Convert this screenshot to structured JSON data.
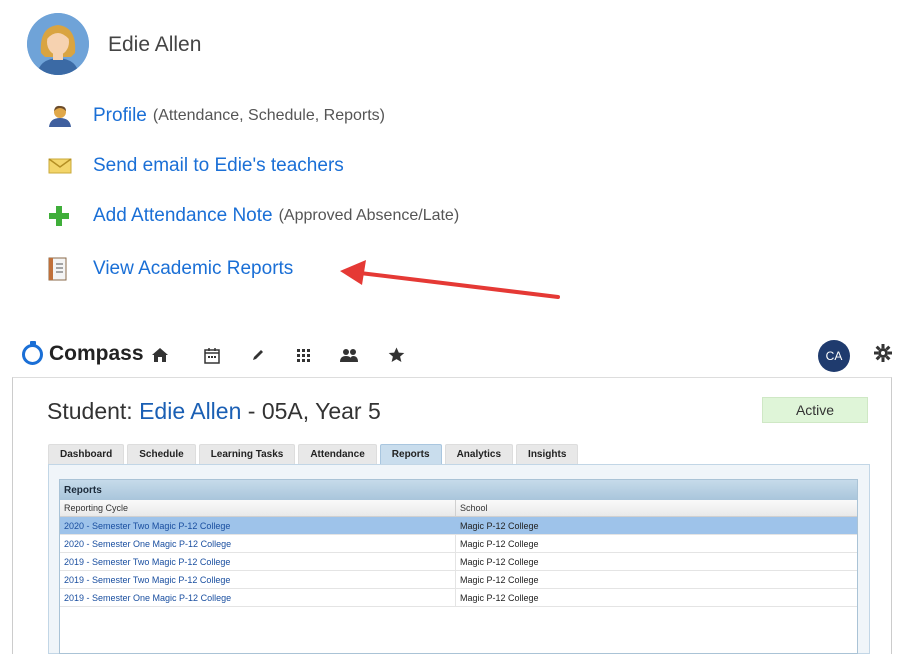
{
  "student": {
    "name": "Edie Allen"
  },
  "menu": {
    "items": [
      {
        "label": "Profile",
        "note": "(Attendance, Schedule, Reports)",
        "icon": "profile-icon"
      },
      {
        "label": "Send email to Edie's teachers",
        "note": "",
        "icon": "envelope-icon"
      },
      {
        "label": "Add Attendance Note",
        "note": "(Approved Absence/Late)",
        "icon": "plus-icon"
      },
      {
        "label": "View Academic Reports",
        "note": "",
        "icon": "report-book-icon"
      }
    ]
  },
  "annotation": {
    "arrow_color": "#e53935"
  },
  "compass": {
    "brand": "Compass",
    "toolbar_icons": [
      "home-icon",
      "calendar-icon",
      "pencil-icon",
      "apps-grid-icon",
      "people-icon",
      "star-icon"
    ],
    "user_initials": "CA",
    "accent": "#1a6fd6"
  },
  "page": {
    "title_prefix": "Student: ",
    "student_link": "Edie Allen",
    "title_suffix": " - 05A, Year 5",
    "status": "Active"
  },
  "tabs": [
    {
      "label": "Dashboard",
      "active": false
    },
    {
      "label": "Schedule",
      "active": false
    },
    {
      "label": "Learning Tasks",
      "active": false
    },
    {
      "label": "Attendance",
      "active": false
    },
    {
      "label": "Reports",
      "active": true
    },
    {
      "label": "Analytics",
      "active": false
    },
    {
      "label": "Insights",
      "active": false
    }
  ],
  "reports": {
    "title": "Reports",
    "columns": [
      "Reporting Cycle",
      "School"
    ],
    "rows": [
      {
        "cycle": "2020 - Semester Two Magic P-12 College",
        "school": "Magic P-12 College",
        "selected": true
      },
      {
        "cycle": "2020 - Semester One Magic P-12 College",
        "school": "Magic P-12 College",
        "selected": false
      },
      {
        "cycle": "2019 - Semester Two Magic P-12 College",
        "school": "Magic P-12 College",
        "selected": false
      },
      {
        "cycle": "2019 - Semester Two Magic P-12 College",
        "school": "Magic P-12 College",
        "selected": false
      },
      {
        "cycle": "2019 - Semester One Magic P-12 College",
        "school": "Magic P-12 College",
        "selected": false
      }
    ]
  }
}
